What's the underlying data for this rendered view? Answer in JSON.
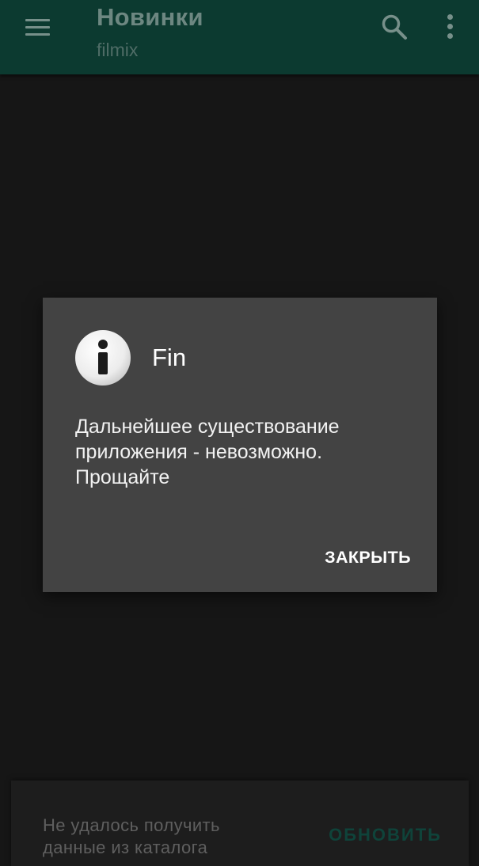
{
  "app_bar": {
    "title": "Новинки",
    "subtitle": "filmix",
    "menu_icon": "hamburger-menu-icon",
    "search_icon": "search-icon",
    "more_icon": "more-vertical-icon",
    "background_color": "#0c3a30"
  },
  "dialog": {
    "icon": "info-icon",
    "title": "Fin",
    "message_lines": [
      "Дальнейшее существование",
      "приложения - невозможно.",
      "Прощайте"
    ],
    "close_label": "ЗАКРЫТЬ",
    "background_color": "#434343"
  },
  "snackbar": {
    "message_lines": [
      "Не удалось получить",
      "данные из каталога"
    ],
    "action_label": "ОБНОВИТЬ",
    "action_color": "#0f433a"
  }
}
